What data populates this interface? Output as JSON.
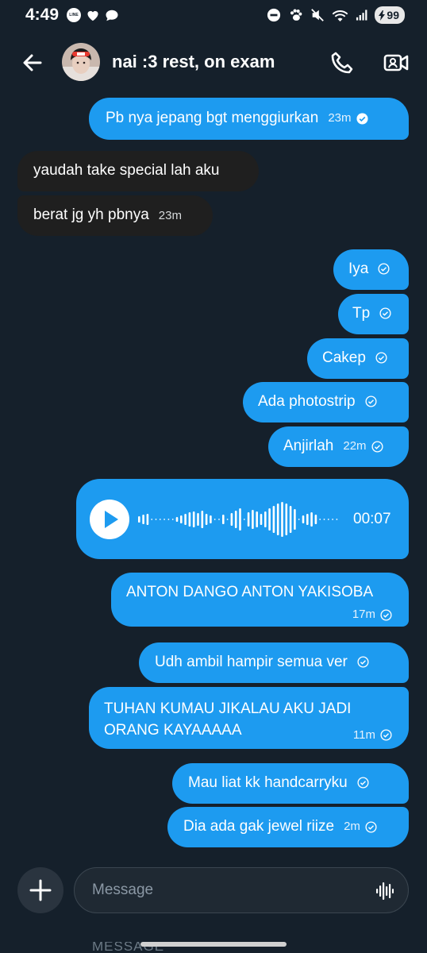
{
  "status_bar": {
    "time": "4:49",
    "line_badge": "LINE",
    "battery": "99"
  },
  "header": {
    "title": "nai :3 rest, on exam"
  },
  "messages": [
    {
      "dir": "out",
      "text": "Pb nya jepang bgt menggiurkan",
      "time": "23m",
      "status": "read"
    },
    {
      "dir": "in",
      "text": "yaudah take special lah aku",
      "time": ""
    },
    {
      "dir": "in",
      "text": "berat jg yh pbnya",
      "time": "23m"
    },
    {
      "dir": "out",
      "text": "Iya",
      "time": "",
      "status": "sent"
    },
    {
      "dir": "out",
      "text": "Tp",
      "time": "",
      "status": "sent"
    },
    {
      "dir": "out",
      "text": "Cakep",
      "time": "",
      "status": "sent"
    },
    {
      "dir": "out",
      "text": "Ada photostrip",
      "time": "",
      "status": "sent"
    },
    {
      "dir": "out",
      "text": "Anjirlah",
      "time": "22m",
      "status": "sent"
    },
    {
      "dir": "out",
      "text": "ANTON DANGO ANTON YAKISOBA",
      "time": "17m",
      "status": "sent"
    },
    {
      "dir": "out",
      "text": "Udh ambil hampir semua ver",
      "time": "",
      "status": "sent"
    },
    {
      "dir": "out",
      "text": "TUHAN KUMAU JIKALAU AKU JADI",
      "text2": "ORANG KAYAAAAA",
      "time": "11m",
      "status": "sent"
    },
    {
      "dir": "out",
      "text": "Mau liat kk handcarryku",
      "time": "",
      "status": "sent"
    },
    {
      "dir": "out",
      "text": "Dia ada gak jewel riize",
      "time": "2m",
      "status": "sent"
    }
  ],
  "voice_message": {
    "duration": "00:07",
    "icon": "play-icon"
  },
  "composer": {
    "placeholder": "Message",
    "ghost_text": "MESSAGE"
  },
  "colors": {
    "background": "#15202b",
    "outgoing_bubble": "#1d9bf0",
    "incoming_bubble": "#1f1f1f"
  }
}
